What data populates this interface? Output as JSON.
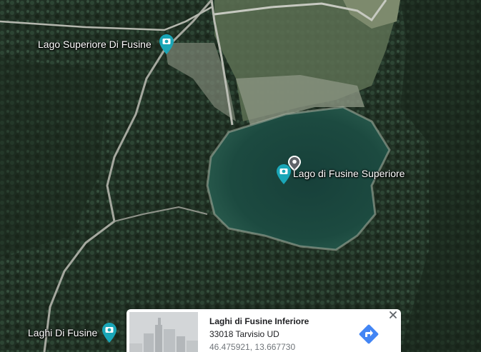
{
  "map": {
    "places": [
      {
        "name": "Lago Superiore Di Fusine"
      },
      {
        "name": "Lago di Fusine Superiore"
      },
      {
        "name": "Laghi Di Fusine"
      }
    ],
    "marker_colors": {
      "photo": "#1aa6b7",
      "location_pin": "#5f6368"
    }
  },
  "info_card": {
    "title": "Laghi di Fusine Inferiore",
    "address": "33018 Tarvisio UD",
    "coordinates": "46.475921, 13.667730",
    "direction_color": "#4285f4"
  }
}
